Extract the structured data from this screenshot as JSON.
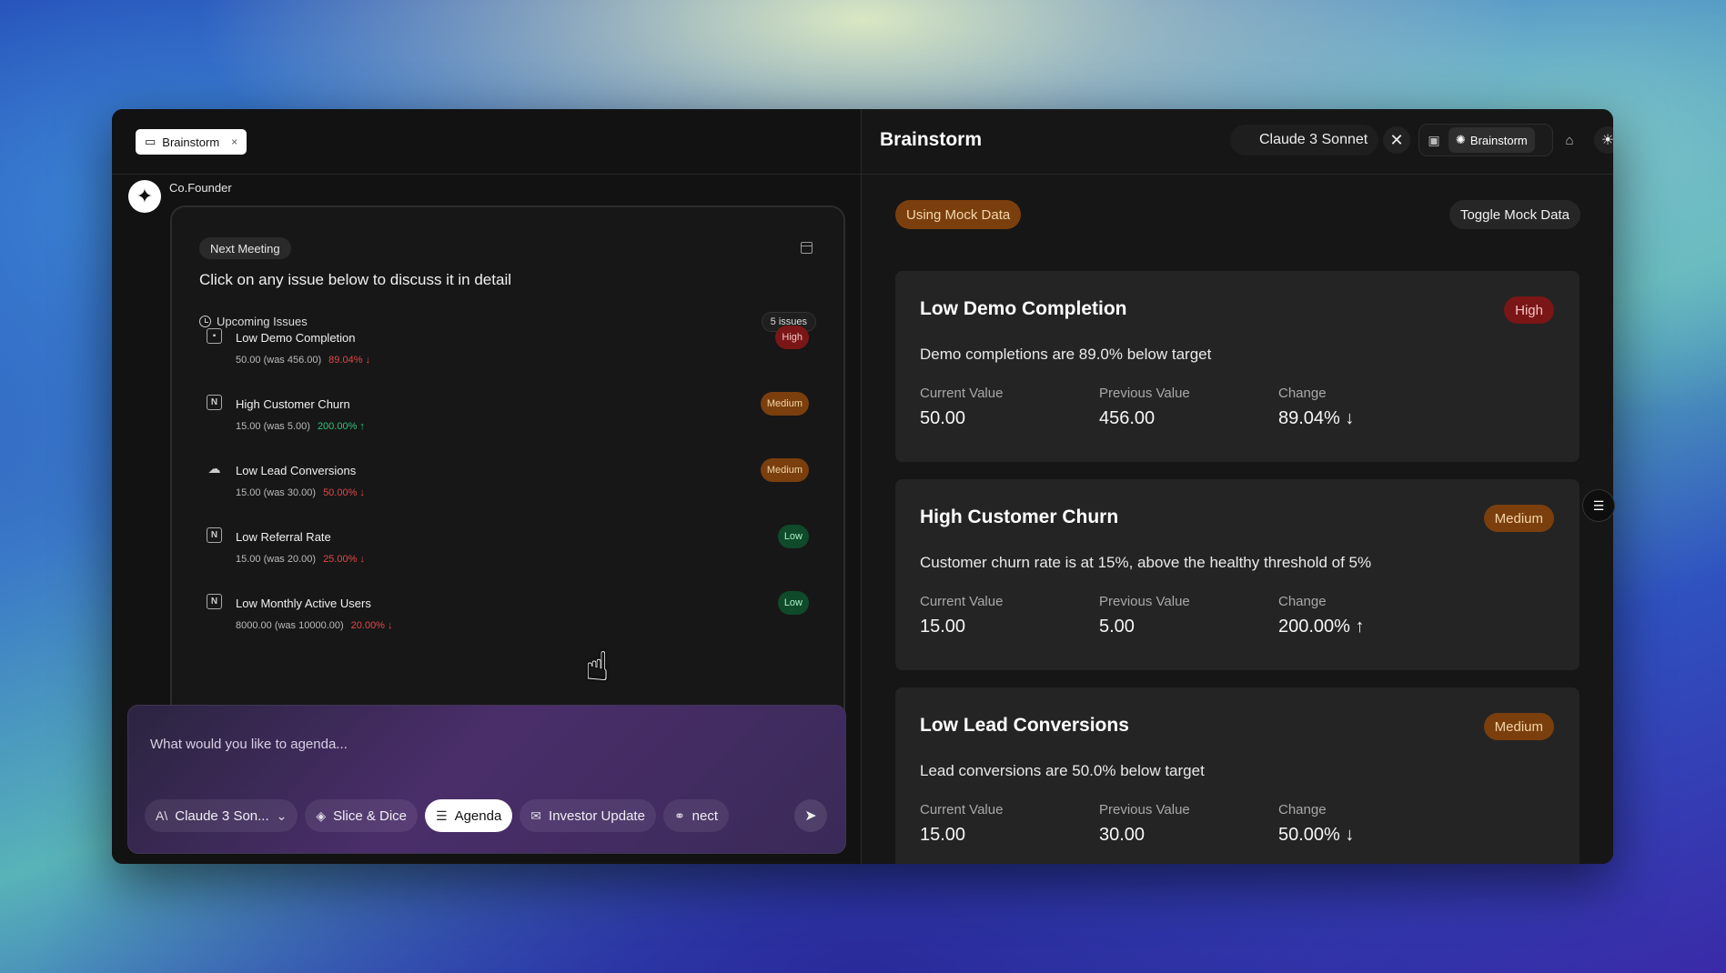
{
  "left": {
    "tab": {
      "label": "Brainstorm",
      "close": "×"
    },
    "assistant_name": "Co.Founder",
    "meeting": {
      "badge": "Next Meeting",
      "instruction": "Click on any issue below to discuss it in detail",
      "section_label": "Upcoming Issues",
      "count": "5 issues",
      "issues": [
        {
          "name": "Low Demo Completion",
          "values": "50.00 (was 456.00)",
          "change": "89.04% ↓",
          "direction": "down",
          "severity": "High",
          "icon": "slack-icon"
        },
        {
          "name": "High Customer Churn",
          "values": "15.00 (was 5.00)",
          "change": "200.00% ↑",
          "direction": "up",
          "severity": "Medium",
          "icon": "notion-icon"
        },
        {
          "name": "Low Lead Conversions",
          "values": "15.00 (was 30.00)",
          "change": "50.00% ↓",
          "direction": "down",
          "severity": "Medium",
          "icon": "salesforce-icon"
        },
        {
          "name": "Low Referral Rate",
          "values": "15.00 (was 20.00)",
          "change": "25.00% ↓",
          "direction": "down",
          "severity": "Low",
          "icon": "notion-icon"
        },
        {
          "name": "Low Monthly Active Users",
          "values": "8000.00 (was 10000.00)",
          "change": "20.00% ↓",
          "direction": "down",
          "severity": "Low",
          "icon": "notion-icon"
        }
      ]
    },
    "composer": {
      "placeholder": "What would you like to agenda...",
      "chips": {
        "model": "Claude 3 Son...",
        "slice": "Slice & Dice",
        "agenda": "Agenda",
        "investor": "Investor Update",
        "connect": "nect"
      }
    }
  },
  "right": {
    "title": "Brainstorm",
    "model": "Claude 3 Sonnet",
    "mode_active": "Brainstorm",
    "mock_badge": "Using Mock Data",
    "toggle_label": "Toggle Mock Data",
    "metric_labels": {
      "current": "Current Value",
      "previous": "Previous Value",
      "change": "Change"
    },
    "cards": [
      {
        "title": "Low Demo Completion",
        "severity": "High",
        "description": "Demo completions are 89.0% below target",
        "current": "50.00",
        "previous": "456.00",
        "change": "89.04% ↓",
        "direction": "down"
      },
      {
        "title": "High Customer Churn",
        "severity": "Medium",
        "description": "Customer churn rate is at 15%, above the healthy threshold of 5%",
        "current": "15.00",
        "previous": "5.00",
        "change": "200.00% ↑",
        "direction": "up"
      },
      {
        "title": "Low Lead Conversions",
        "severity": "Medium",
        "description": "Lead conversions are 50.0% below target",
        "current": "15.00",
        "previous": "30.00",
        "change": "50.00% ↓",
        "direction": "down"
      }
    ]
  },
  "colors": {
    "high": "#7a1616",
    "medium": "#7a3f0d",
    "low": "#0f4a2a",
    "down": "#e04848",
    "up": "#35c07a"
  }
}
